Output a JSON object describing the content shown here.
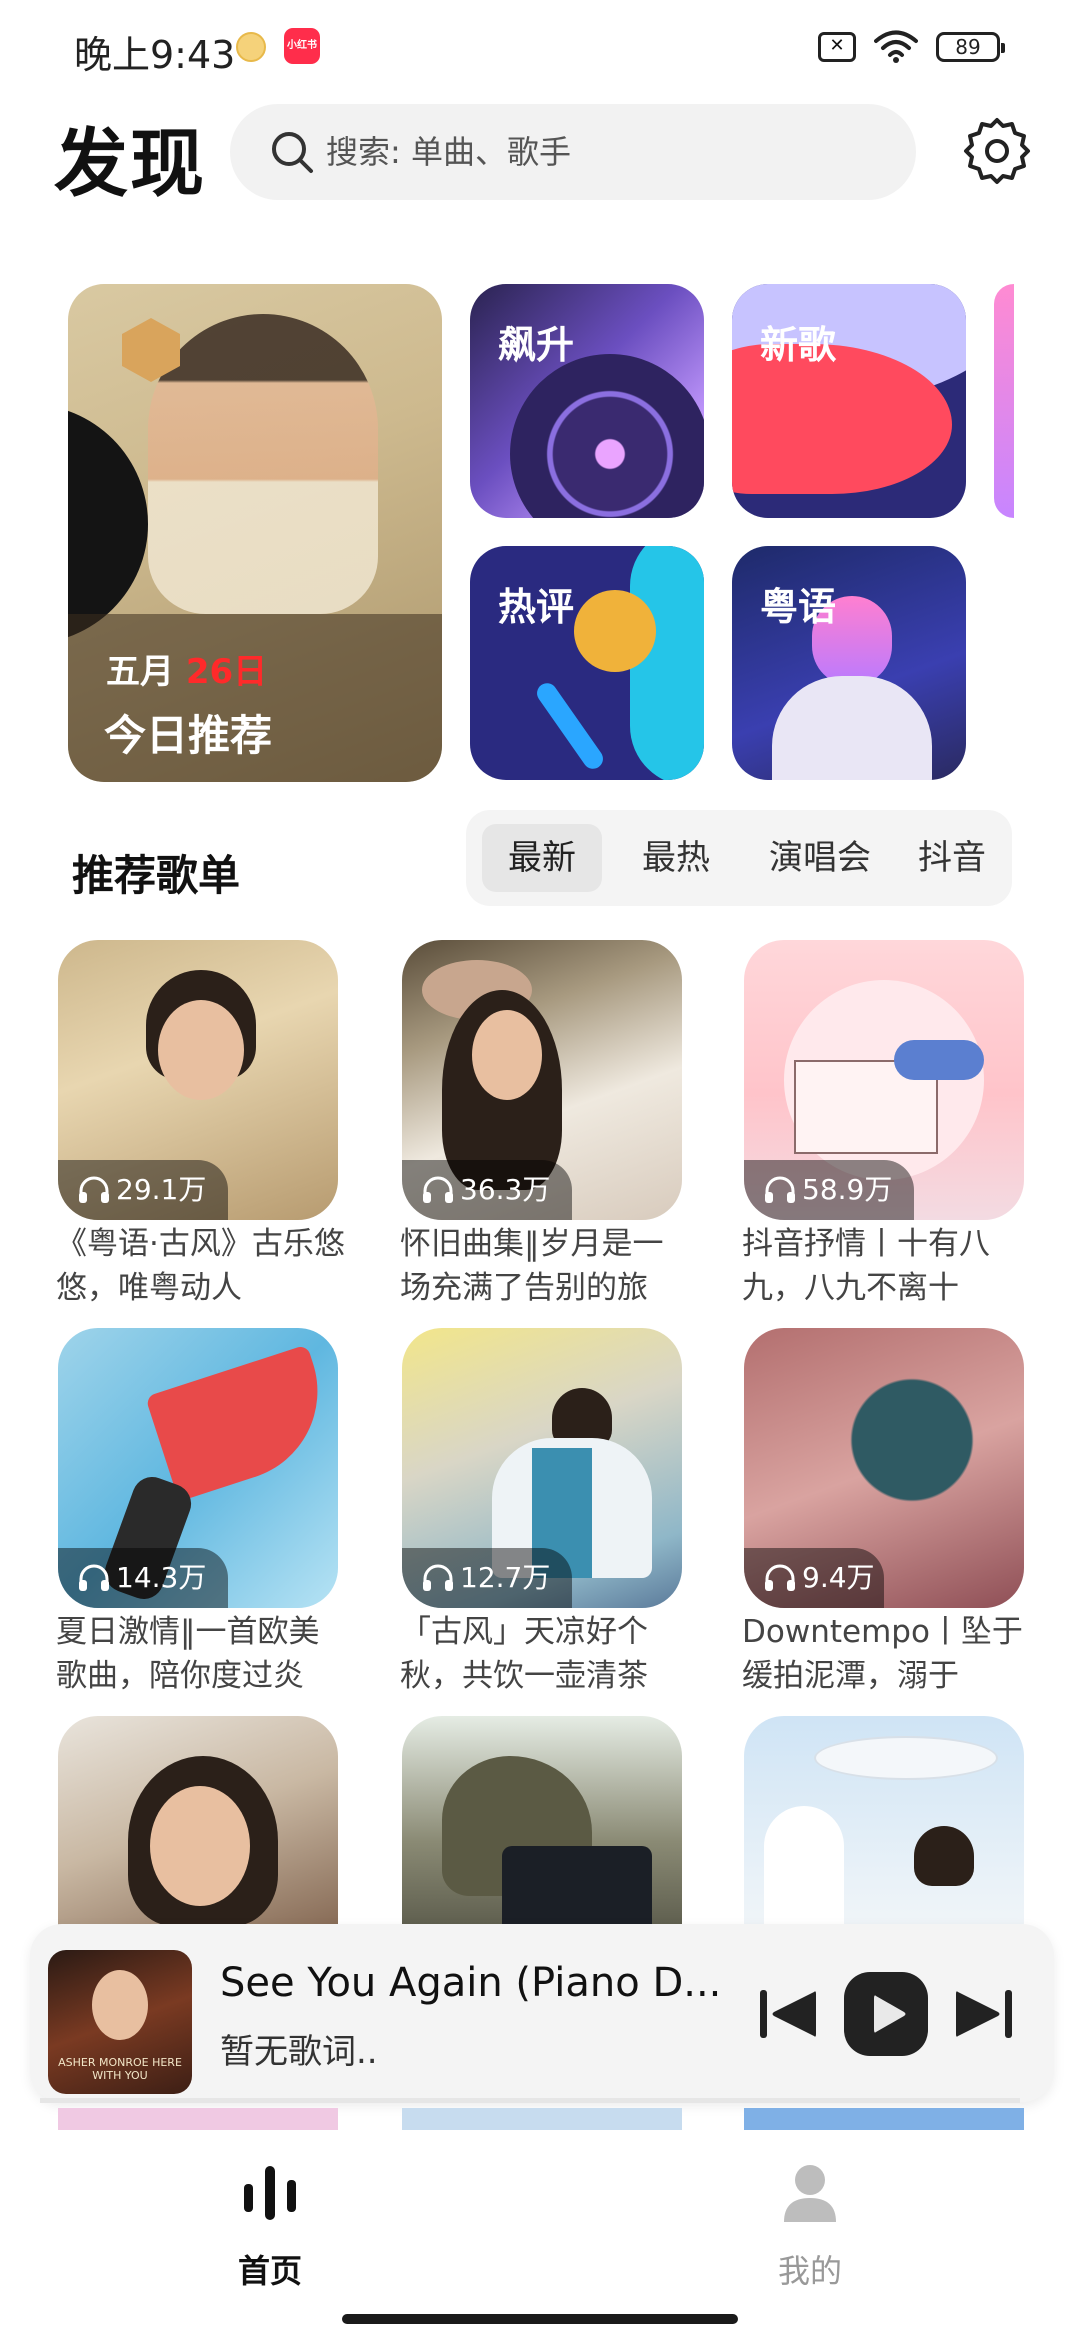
{
  "status": {
    "time": "晚上9:43",
    "app_icon_text": "小红书",
    "sim": "✕",
    "battery": "89"
  },
  "header": {
    "title": "发现",
    "search_placeholder": "搜索: 单曲、歌手"
  },
  "feature": {
    "daily": {
      "month": "五月",
      "day": "26日",
      "label": "今日推荐"
    },
    "tiles": [
      {
        "label": "飙升"
      },
      {
        "label": "新歌"
      },
      {
        "label": "热评"
      },
      {
        "label": "粤语"
      }
    ]
  },
  "playlists": {
    "section_title": "推荐歌单",
    "tabs": [
      "最新",
      "最热",
      "演唱会",
      "抖音"
    ],
    "active_tab": "最新",
    "items": [
      {
        "plays": "29.1万",
        "title": "《粤语·古风》古乐悠悠，唯粤动人"
      },
      {
        "plays": "36.3万",
        "title": "怀旧曲集‖岁月是一场充满了告别的旅"
      },
      {
        "plays": "58.9万",
        "title": "抖音抒情丨十有八九，八九不离十"
      },
      {
        "plays": "14.3万",
        "title": "夏日激情‖一首欧美歌曲，陪你度过炎"
      },
      {
        "plays": "12.7万",
        "title": "「古风」天凉好个秋，共饮一壶清茶"
      },
      {
        "plays": "9.4万",
        "title": "Downtempo丨坠于缓拍泥潭，溺于"
      },
      {
        "plays": "",
        "title": ""
      },
      {
        "plays": "",
        "title": ""
      },
      {
        "plays": "",
        "title": ""
      }
    ]
  },
  "player": {
    "song": "See You Again (Piano D...",
    "lyric": "暂无歌词..",
    "cover_text": "ASHER MONROE HERE WITH YOU",
    "progress": 0.0
  },
  "nav": {
    "home_label": "首页",
    "mine_label": "我的"
  },
  "colors": {
    "accent": "#ff2a2a",
    "background": "#ffffff"
  }
}
